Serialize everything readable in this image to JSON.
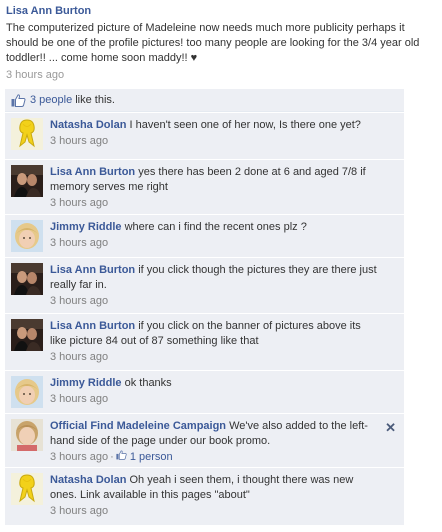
{
  "post": {
    "author": "Lisa Ann Burton",
    "text": "The computerized picture of Madeleine now needs much more publicity perhaps it should be one of the profile pictures! too many people are looking for the 3/4 year old toddler!! ... come home soon maddy!! ♥",
    "time": "3 hours ago"
  },
  "likes": {
    "count_link": "3 people",
    "suffix": "like this."
  },
  "comments": [
    {
      "author": "Natasha Dolan",
      "text": "I haven't seen one of her now, Is there one yet?",
      "time": "3 hours ago"
    },
    {
      "author": "Lisa Ann Burton",
      "text": "yes there has been 2 done at 6 and aged 7/8 if memory serves me right",
      "time": "3 hours ago"
    },
    {
      "author": "Jimmy Riddle",
      "text": "where can i find the recent ones plz ?",
      "time": "3 hours ago"
    },
    {
      "author": "Lisa Ann Burton",
      "text": "if you click though the pictures they are there just really far in.",
      "time": "3 hours ago"
    },
    {
      "author": "Lisa Ann Burton",
      "text": "if you click on the banner of pictures above its like picture 84 out of 87 something like that",
      "time": "3 hours ago"
    },
    {
      "author": "Jimmy Riddle",
      "text": "ok thanks",
      "time": "3 hours ago"
    },
    {
      "author": "Official Find Madeleine Campaign",
      "text": "We've also added to the left-hand side of the page under our book promo.",
      "time": "3 hours ago",
      "like_count": "1 person",
      "close_symbol": "✕"
    },
    {
      "author": "Natasha Dolan",
      "text": "Oh yeah i seen them, i thought there was new ones. Link available in this pages \"about\"",
      "time": "3 hours ago"
    }
  ],
  "colors": {
    "link": "#3b5998",
    "comment_bg": "#edeff4",
    "time": "#999999"
  }
}
